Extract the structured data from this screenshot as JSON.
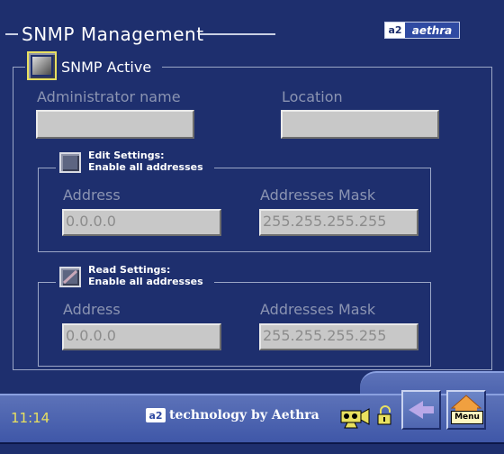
{
  "header": {
    "title": "SNMP Management",
    "logo_mark": "a2",
    "logo_text": "aethra"
  },
  "snmp": {
    "active_label": "SNMP Active",
    "admin_label": "Administrator name",
    "admin_value": "",
    "location_label": "Location",
    "location_value": ""
  },
  "edit_settings": {
    "title": "Edit Settings:",
    "subtitle": "Enable all addresses",
    "address_label": "Address",
    "address_value": "0.0.0.0",
    "mask_label": "Addresses Mask",
    "mask_value": "255.255.255.255"
  },
  "read_settings": {
    "title": "Read Settings:",
    "subtitle": "Enable all addresses",
    "address_label": "Address",
    "address_value": "0.0.0.0",
    "mask_label": "Addresses Mask",
    "mask_value": "255.255.255.255"
  },
  "status_bar": {
    "time": "11:14",
    "brand_mark": "a2",
    "brand_text": "technology by Aethra",
    "menu_label": "Menu",
    "icons": [
      "camera-icon",
      "lock-icon",
      "back-arrow-icon",
      "home-menu-icon"
    ]
  },
  "colors": {
    "background": "#1e2f6e",
    "accent_yellow": "#e8e060"
  }
}
